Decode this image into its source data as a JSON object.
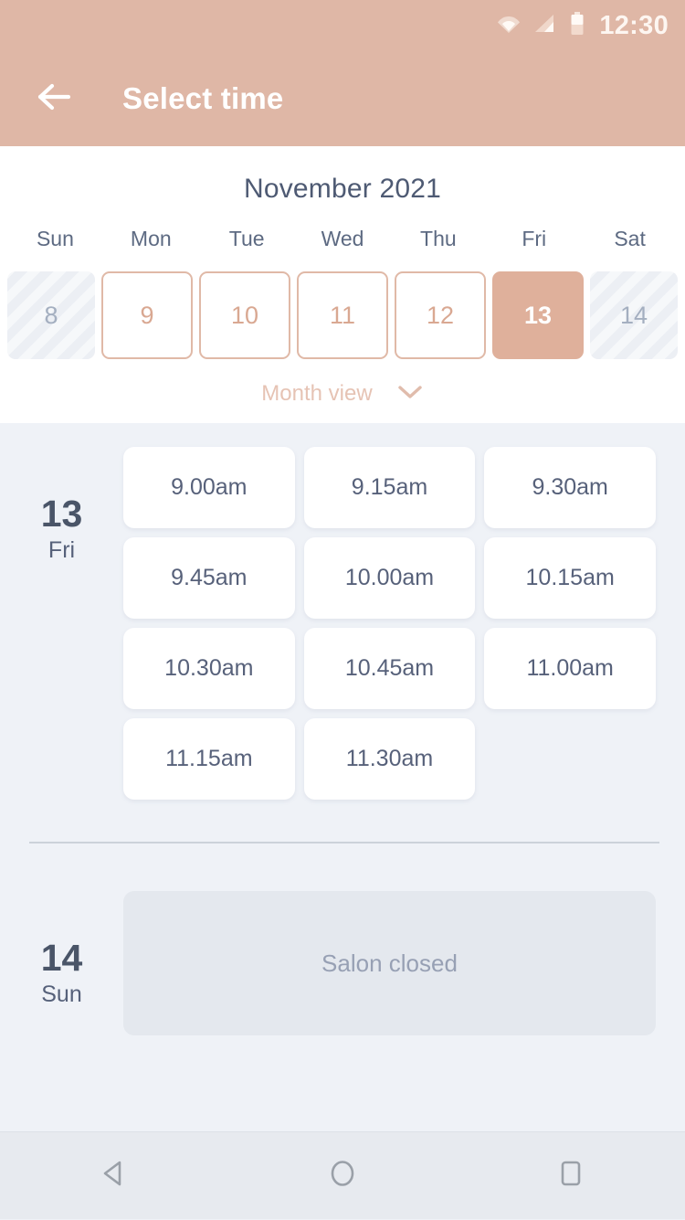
{
  "status_bar": {
    "clock": "12:30",
    "icons": [
      "wifi-icon",
      "signal-icon",
      "battery-icon"
    ]
  },
  "app_bar": {
    "back_icon": "arrow-left-icon",
    "title": "Select time"
  },
  "calendar": {
    "month_title": "November 2021",
    "weekdays": [
      "Sun",
      "Mon",
      "Tue",
      "Wed",
      "Thu",
      "Fri",
      "Sat"
    ],
    "dates": [
      {
        "day": "8",
        "state": "disabled"
      },
      {
        "day": "9",
        "state": "available"
      },
      {
        "day": "10",
        "state": "available"
      },
      {
        "day": "11",
        "state": "available"
      },
      {
        "day": "12",
        "state": "available"
      },
      {
        "day": "13",
        "state": "selected"
      },
      {
        "day": "14",
        "state": "disabled"
      }
    ],
    "month_view_label": "Month view",
    "month_view_icon": "chevron-down-icon"
  },
  "schedule": [
    {
      "day_number": "13",
      "day_of_week": "Fri",
      "slots": [
        "9.00am",
        "9.15am",
        "9.30am",
        "9.45am",
        "10.00am",
        "10.15am",
        "10.30am",
        "10.45am",
        "11.00am",
        "11.15am",
        "11.30am"
      ]
    },
    {
      "day_number": "14",
      "day_of_week": "Sun",
      "slots": [],
      "closed_message": "Salon closed"
    }
  ],
  "nav_bar": {
    "back_label": "back-triangle-icon",
    "home_label": "home-circle-icon",
    "recents_label": "recents-square-icon"
  },
  "colors": {
    "accent_rose": "#dfb7a6",
    "accent_rose_dark": "#dfb09b",
    "accent_rose_light": "#e6c3b4",
    "body_bg": "#eff2f7",
    "text_dark": "#4a5568",
    "text_muted": "#97a0b4",
    "card_white": "#ffffff",
    "closed_card": "#e4e8ee"
  }
}
